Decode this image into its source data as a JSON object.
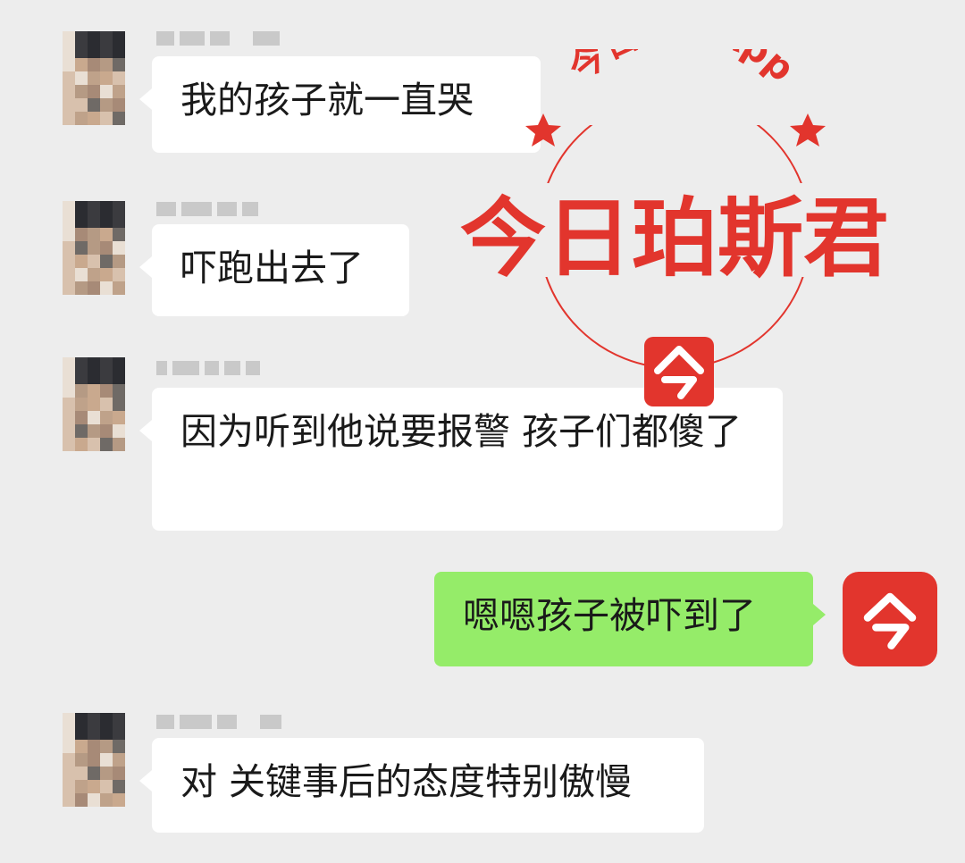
{
  "chat": {
    "messages": [
      {
        "side": "left",
        "text": "我的孩子就一直哭"
      },
      {
        "side": "left",
        "text": "吓跑出去了"
      },
      {
        "side": "left",
        "text": "因为听到他说要报警 孩子们都傻了"
      },
      {
        "side": "right",
        "text": "嗯嗯孩子被吓到了"
      },
      {
        "side": "left",
        "text": "对 关键事后的态度特别傲慢"
      }
    ]
  },
  "watermark": {
    "top_arc_text": "今日澳洲App",
    "main_text": "今日珀斯君",
    "logo_glyph": "今"
  },
  "colors": {
    "bg": "#ededed",
    "bubble_other": "#ffffff",
    "bubble_mine": "#95ec69",
    "brand_red": "#e2352d"
  }
}
